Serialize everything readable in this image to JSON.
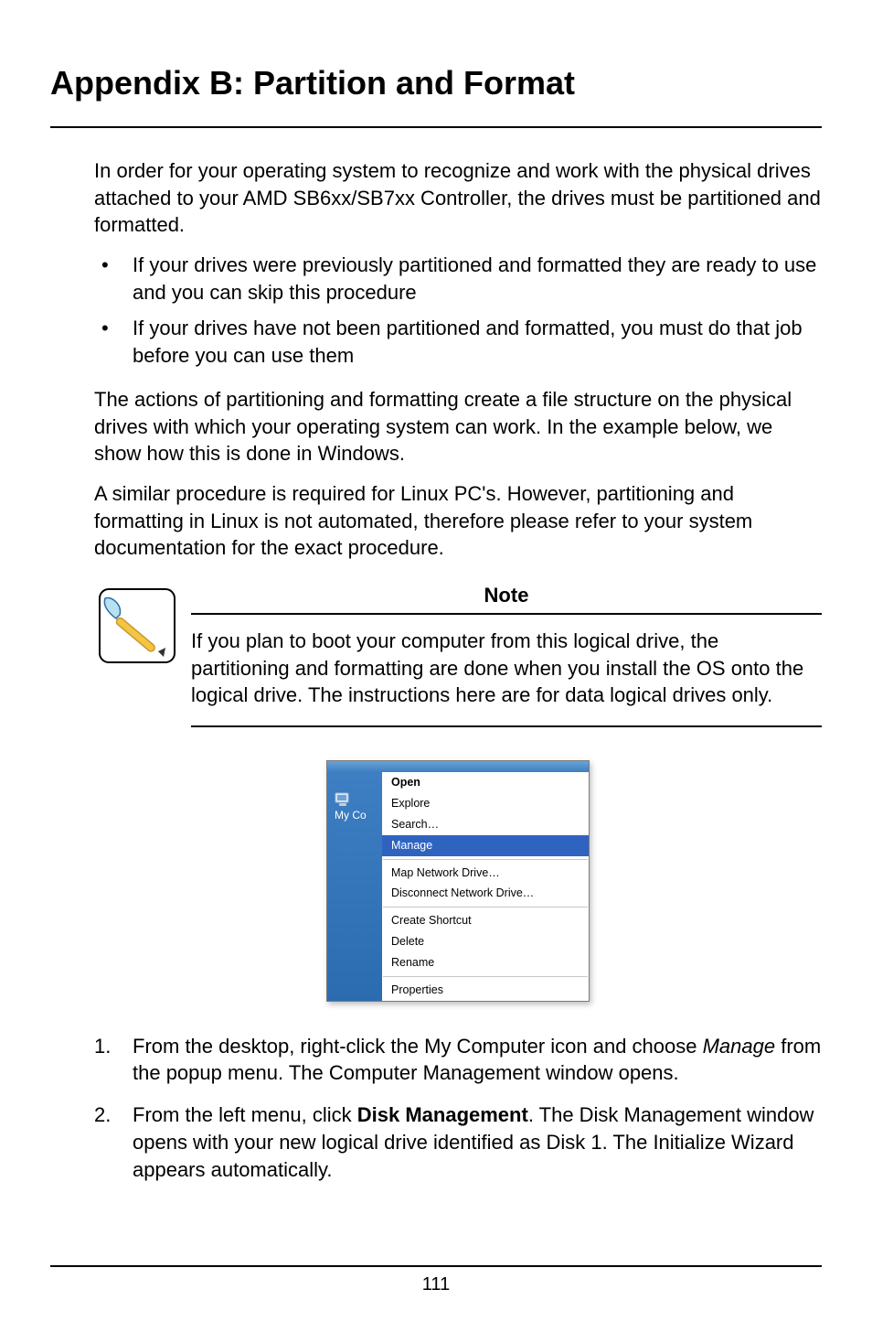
{
  "page": {
    "title": "Appendix B: Partition and Format",
    "intro": "In order for your operating system to recognize and work with the physical drives attached to your AMD SB6xx/SB7xx Controller, the drives must be partitioned and formatted.",
    "bullets": [
      "If your drives were previously partitioned and formatted they are ready to use and you can skip this procedure",
      "If your drives have not been partitioned and formatted, you must do that job before you can use them"
    ],
    "para2": "The actions of partitioning and formatting create a file structure on the physical drives with which your operating system can work. In the example below, we show how this is done in Windows.",
    "para3": "A similar procedure is required for Linux PC's. However, partitioning and formatting in Linux is not automated, therefore please refer to your system documentation for the exact procedure.",
    "note": {
      "title": "Note",
      "text": "If you plan to boot your computer from this logical drive, the partitioning and formatting are done when you install the OS onto the logical drive. The instructions here are for data logical drives only."
    },
    "context_menu": {
      "left_label": "My Co",
      "items": [
        {
          "label": "Open",
          "bold": true
        },
        {
          "label": "Explore"
        },
        {
          "label": "Search…"
        },
        {
          "label": "Manage",
          "selected": true
        },
        {
          "sep": true
        },
        {
          "label": "Map Network Drive…"
        },
        {
          "label": "Disconnect Network Drive…"
        },
        {
          "sep": true
        },
        {
          "label": "Create Shortcut"
        },
        {
          "label": "Delete"
        },
        {
          "label": "Rename"
        },
        {
          "sep": true
        },
        {
          "label": "Properties"
        }
      ]
    },
    "steps": {
      "s1a": "From the desktop, right-click the My Computer icon and choose ",
      "s1_em": "Manage",
      "s1b": " from the popup menu. The Computer Management window opens.",
      "s2a": "From the left menu, click ",
      "s2_strong": "Disk Management",
      "s2b": ". The Disk Management window opens with your new logical drive identified as Disk 1. The Initialize Wizard appears automatically."
    },
    "page_number": "111"
  }
}
